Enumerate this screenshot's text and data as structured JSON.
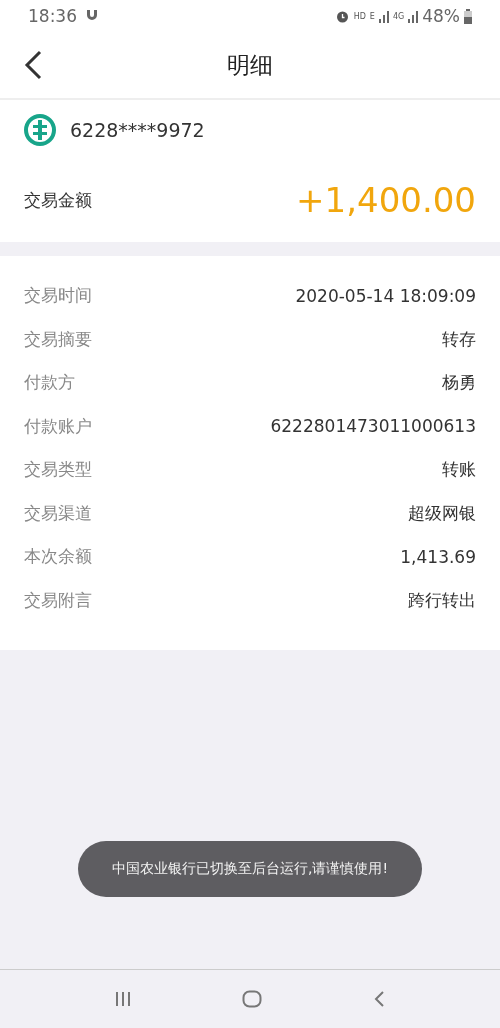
{
  "status_bar": {
    "time": "18:36",
    "network_labels": [
      "HD",
      "E",
      "4G"
    ],
    "battery": "48%"
  },
  "header": {
    "title": "明细"
  },
  "account": {
    "number": "6228****9972"
  },
  "amount": {
    "label": "交易金额",
    "value": "+1,400.00"
  },
  "details": [
    {
      "label": "交易时间",
      "value": "2020-05-14 18:09:09"
    },
    {
      "label": "交易摘要",
      "value": "转存"
    },
    {
      "label": "付款方",
      "value": "杨勇"
    },
    {
      "label": "付款账户",
      "value": "6222801473011000613"
    },
    {
      "label": "交易类型",
      "value": "转账"
    },
    {
      "label": "交易渠道",
      "value": "超级网银"
    },
    {
      "label": "本次余额",
      "value": "1,413.69"
    },
    {
      "label": "交易附言",
      "value": "跨行转出"
    }
  ],
  "toast": "中国农业银行已切换至后台运行,请谨慎使用!"
}
